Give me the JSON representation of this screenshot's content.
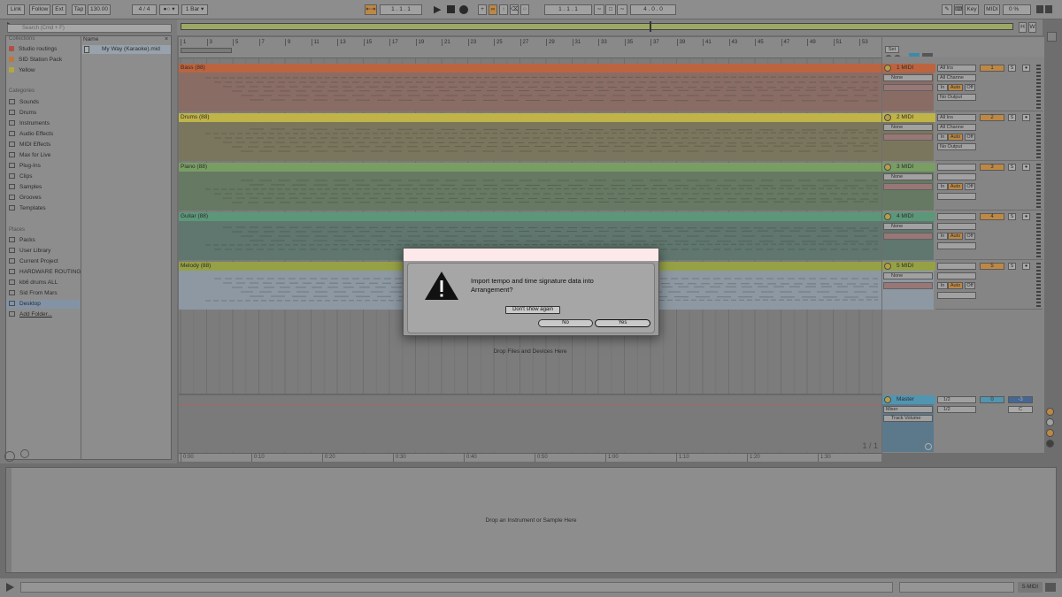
{
  "toolbar": {
    "link": "Link",
    "follow": "Follow",
    "ext": "Ext",
    "tap": "Tap",
    "tempo": "130.00",
    "signature": "4 / 4",
    "metronome": "●○ ▾",
    "quantize": "1 Bar ▾",
    "position": "1 .   1 .   1",
    "loop_start": "1 .   1 .   1",
    "loop_length": "4 .   0 .   0",
    "key": "Key",
    "midi": "MIDI",
    "cpu": "0 %"
  },
  "overview": {
    "h": "H",
    "w": "W"
  },
  "browser": {
    "search_placeholder": "Search (Cmd + F)",
    "collections_header": "Collections",
    "collections": [
      "Studio routings",
      "SID Station Pack",
      "Yellow"
    ],
    "collection_colors": [
      "#e04a3a",
      "#f28d2a",
      "#e5d12a"
    ],
    "categories_header": "Categories",
    "categories": [
      "Sounds",
      "Drums",
      "Instruments",
      "Audio Effects",
      "MIDI Effects",
      "Max for Live",
      "Plug-Ins",
      "Clips",
      "Samples",
      "Grooves",
      "Templates"
    ],
    "places_header": "Places",
    "places": [
      "Packs",
      "User Library",
      "Current Project",
      "HARDWARE ROUTING",
      "kb6 drums ALL",
      "Sid From Mars",
      "Desktop",
      "Add Folder..."
    ],
    "name_header": "Name",
    "file": "My Way (Karaoke).mid"
  },
  "ruler": {
    "bars": [
      "1",
      "3",
      "5",
      "7",
      "9",
      "11",
      "13",
      "15",
      "17",
      "19",
      "21",
      "23",
      "25",
      "27",
      "29",
      "31",
      "33",
      "35",
      "37",
      "39",
      "41",
      "43",
      "45",
      "47",
      "49",
      "51",
      "53"
    ],
    "set": "Set"
  },
  "tracks": [
    {
      "clip": "Bass (88)",
      "name": "1 MIDI",
      "color": "#f26a32",
      "clipbg": "#a4786c",
      "num": "1",
      "input_type": "All Ins",
      "channel": "All Channe",
      "output": "No Output",
      "device": "None"
    },
    {
      "clip": "Drums (88)",
      "name": "2 MIDI",
      "color": "#f7e53f",
      "clipbg": "#8d8660",
      "num": "2",
      "input_type": "All Ins",
      "channel": "All Channe",
      "output": "No Output",
      "device": "None"
    },
    {
      "clip": "Piano (88)",
      "name": "3 MIDI",
      "color": "#8ac36a",
      "clipbg": "#6d8a68",
      "num": "3",
      "input_type": "",
      "channel": "",
      "output": "",
      "device": "None"
    },
    {
      "clip": "Guitar (88)",
      "name": "4 MIDI",
      "color": "#5fb98a",
      "clipbg": "#63877a",
      "num": "4",
      "input_type": "",
      "channel": "",
      "output": "",
      "device": "None"
    },
    {
      "clip": "Melody (88)",
      "name": "5 MIDI",
      "color": "#b5c83a",
      "clipbg": "#a9bac9",
      "num": "5",
      "input_type": "",
      "channel": "",
      "output": "",
      "device": "None"
    }
  ],
  "monitor": {
    "in": "In",
    "auto": "Auto",
    "off": "Off",
    "s": "S"
  },
  "drop_files": "Drop Files and Devices Here",
  "master": {
    "name": "Master",
    "mixer": "Mixer",
    "automation": "Track Volume",
    "q1": "1/2",
    "q2": "1/2",
    "volume": "0",
    "pan": "C",
    "meter": "-3",
    "page": "1 / 1"
  },
  "timeline": [
    "0:00",
    "0:10",
    "0:20",
    "0:30",
    "0:40",
    "0:50",
    "1:00",
    "1:10",
    "1:20",
    "1:30"
  ],
  "detail_hint": "Drop an Instrument or Sample Here",
  "status_track": "5-MIDI",
  "dialog": {
    "message": "Import tempo and time signature data into Arrangement?",
    "dont_show": "Don't show again",
    "no": "No",
    "yes": "Yes"
  }
}
